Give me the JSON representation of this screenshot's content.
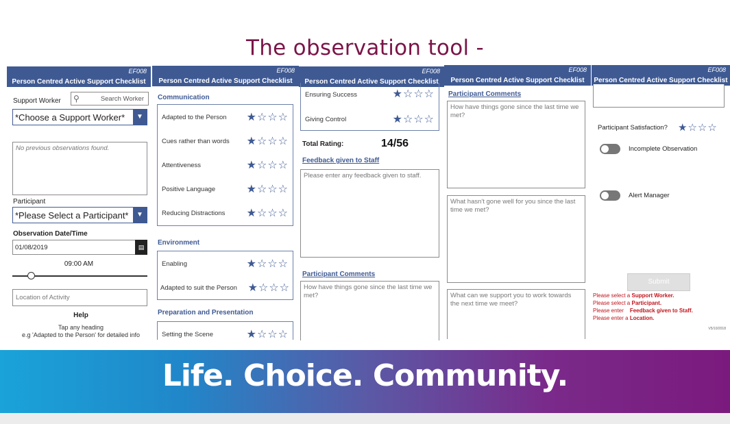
{
  "slide_title": "The observation tool -",
  "form_code": "EF008",
  "form_title": "Person Centred Active Support Checklist",
  "panel1": {
    "support_worker_label": "Support Worker",
    "search_placeholder": "Search Worker",
    "worker_dropdown_value": "*Choose a Support Worker*",
    "no_observations_text": "No previous observations found.",
    "participant_label": "Participant",
    "participant_dropdown_value": "*Please Select a Participant*",
    "date_label": "Observation Date/Time",
    "date_value": "01/08/2019",
    "time_value": "09:00 AM",
    "location_placeholder": "Location of Activity",
    "help_heading": "Help",
    "help_line1": "Tap any heading",
    "help_line2": "e.g 'Adapted to the Person' for detailed info"
  },
  "panel2": {
    "section_communication": "Communication",
    "communication_items": [
      {
        "label": "Adapted to the Person",
        "stars": "★☆☆☆"
      },
      {
        "label": "Cues rather than words",
        "stars": "★☆☆☆"
      },
      {
        "label": "Attentiveness",
        "stars": "★☆☆☆"
      },
      {
        "label": "Positive Language",
        "stars": "★☆☆☆"
      },
      {
        "label": "Reducing Distractions",
        "stars": "★☆☆☆"
      }
    ],
    "section_environment": "Environment",
    "environment_items": [
      {
        "label": "Enabling",
        "stars": "★☆☆☆"
      },
      {
        "label": "Adapted to suit the Person",
        "stars": "★☆☆☆"
      }
    ],
    "section_preparation": "Preparation and Presentation",
    "preparation_items": [
      {
        "label": "Setting the Scene",
        "stars": "★☆☆☆"
      }
    ]
  },
  "panel3": {
    "items": [
      {
        "label": "Ensuring Success",
        "stars": "★☆☆☆"
      },
      {
        "label": "Giving Control",
        "stars": "★☆☆☆"
      }
    ],
    "total_rating_label": "Total Rating:",
    "total_rating_value": "14/56",
    "feedback_heading": "Feedback given to Staff",
    "feedback_placeholder": "Please enter any feedback given to staff.",
    "participant_comments_heading": "Participant Comments",
    "comments_placeholder": "How have things gone since the last time we met?"
  },
  "panel4": {
    "participant_comments_heading": "Participant Comments",
    "q1_placeholder": "How have things gone since the last time we met?",
    "q2_placeholder": "What hasn't gone well for you since the last time we met?",
    "q3_placeholder": "What can we support you to work towards the next time we meet?"
  },
  "panel5": {
    "satisfaction_label": "Participant Satisfaction?",
    "satisfaction_stars": "★☆☆☆",
    "toggle1_label": "Incomplete Observation",
    "toggle2_label": "Alert Manager",
    "submit_label": "Submit",
    "errors": [
      {
        "prefix": "Please select a ",
        "bold": "Support Worker."
      },
      {
        "prefix": "Please select a ",
        "bold": "Participant."
      },
      {
        "prefix": "Please enter    ",
        "bold": "Feedback given to Staff."
      },
      {
        "prefix": "Please enter a ",
        "bold": "Location."
      }
    ],
    "version": "V5/10/2018"
  },
  "banner_tagline": "Life. Choice. Community.",
  "colors": {
    "header_blue": "#3f5a93",
    "title_maroon": "#7a1548",
    "error_red": "#c0141c"
  }
}
